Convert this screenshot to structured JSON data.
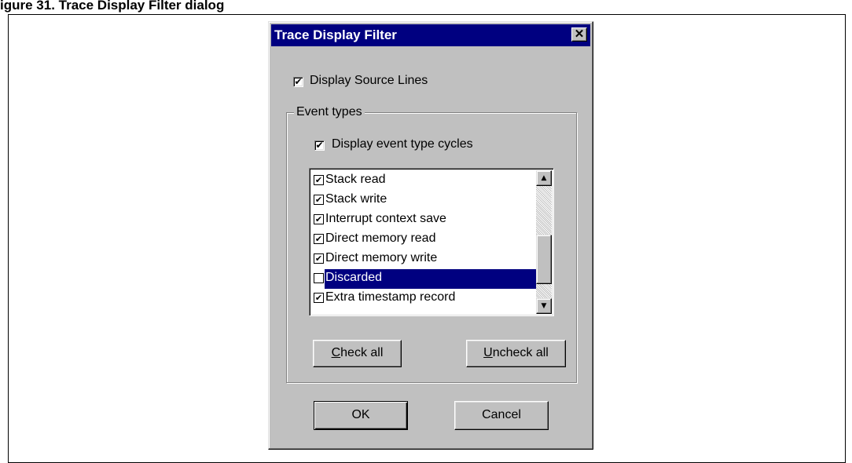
{
  "page_heading": "igure 31. Trace Display Filter dialog",
  "dialog": {
    "title": "Trace Display Filter",
    "close_glyph": "✕",
    "display_source_lines": {
      "label": "Display Source Lines",
      "checked": true
    },
    "event_types": {
      "group_label": "Event types",
      "display_cycles": {
        "label": "Display event type cycles",
        "checked": true
      },
      "items": [
        {
          "label": "Stack read",
          "checked": true,
          "selected": false
        },
        {
          "label": "Stack write",
          "checked": true,
          "selected": false
        },
        {
          "label": "Interrupt context save",
          "checked": true,
          "selected": false
        },
        {
          "label": "Direct memory read",
          "checked": true,
          "selected": false
        },
        {
          "label": "Direct memory write",
          "checked": true,
          "selected": false
        },
        {
          "label": "Discarded",
          "checked": false,
          "selected": true
        },
        {
          "label": "Extra timestamp record",
          "checked": true,
          "selected": false
        }
      ],
      "check_all": {
        "mnemonic": "C",
        "rest": "heck all"
      },
      "uncheck_all": {
        "mnemonic": "U",
        "rest": "ncheck all"
      }
    },
    "ok_label": "OK",
    "cancel_label": "Cancel"
  },
  "colors": {
    "dialog_face": "#c0c0c0",
    "titlebar": "#000080",
    "selection": "#000080"
  },
  "icons": {
    "checkmark": "✔",
    "scroll_up": "▲",
    "scroll_down": "▼"
  }
}
